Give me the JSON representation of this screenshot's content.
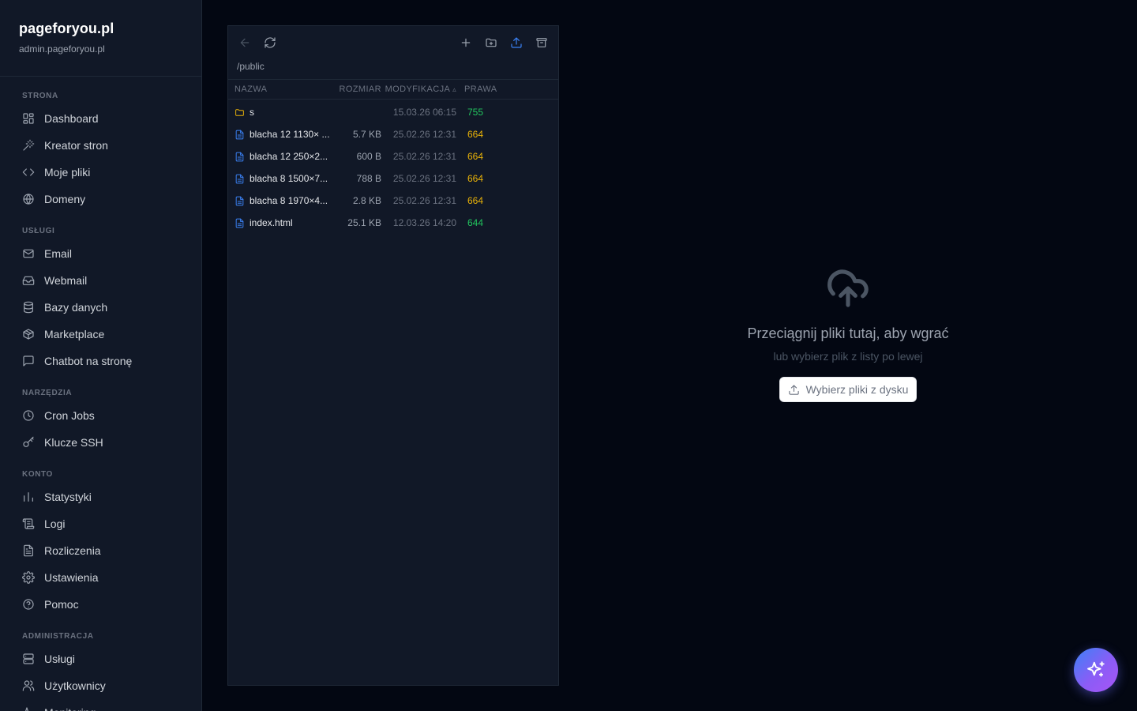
{
  "brand": {
    "title": "pageforyou.pl",
    "subtitle": "admin.pageforyou.pl"
  },
  "sidebar": {
    "sections": [
      {
        "title": "STRONA",
        "items": [
          {
            "label": "Dashboard",
            "icon": "dashboard-icon"
          },
          {
            "label": "Kreator stron",
            "icon": "wand-icon"
          },
          {
            "label": "Moje pliki",
            "icon": "code-icon"
          },
          {
            "label": "Domeny",
            "icon": "globe-icon"
          }
        ]
      },
      {
        "title": "USŁUGI",
        "items": [
          {
            "label": "Email",
            "icon": "mail-icon"
          },
          {
            "label": "Webmail",
            "icon": "inbox-icon"
          },
          {
            "label": "Bazy danych",
            "icon": "database-icon"
          },
          {
            "label": "Marketplace",
            "icon": "package-icon"
          },
          {
            "label": "Chatbot na stronę",
            "icon": "chat-icon"
          }
        ]
      },
      {
        "title": "NARZĘDZIA",
        "items": [
          {
            "label": "Cron Jobs",
            "icon": "clock-icon"
          },
          {
            "label": "Klucze SSH",
            "icon": "key-icon"
          }
        ]
      },
      {
        "title": "KONTO",
        "items": [
          {
            "label": "Statystyki",
            "icon": "bar-chart-icon"
          },
          {
            "label": "Logi",
            "icon": "scroll-icon"
          },
          {
            "label": "Rozliczenia",
            "icon": "receipt-icon"
          },
          {
            "label": "Ustawienia",
            "icon": "gear-icon"
          },
          {
            "label": "Pomoc",
            "icon": "help-icon"
          }
        ]
      },
      {
        "title": "ADMINISTRACJA",
        "items": [
          {
            "label": "Usługi",
            "icon": "server-icon"
          },
          {
            "label": "Użytkownicy",
            "icon": "users-icon"
          },
          {
            "label": "Monitoring",
            "icon": "activity-icon"
          }
        ]
      }
    ]
  },
  "file_panel": {
    "path": "/public",
    "columns": {
      "name": "NAZWA",
      "size": "ROZMIAR",
      "modified": "MODYFIKACJA",
      "sort_indicator": "▵",
      "perms": "PRAWA"
    },
    "files": [
      {
        "type": "folder",
        "name": "s",
        "size": "",
        "modified": "15.03.26 06:15",
        "perms": "755"
      },
      {
        "type": "file",
        "name": "blacha 12 1130× ...",
        "size": "5.7 KB",
        "modified": "25.02.26 12:31",
        "perms": "664"
      },
      {
        "type": "file",
        "name": "blacha 12 250×2...",
        "size": "600 B",
        "modified": "25.02.26 12:31",
        "perms": "664"
      },
      {
        "type": "file",
        "name": "blacha 8 1500×7...",
        "size": "788 B",
        "modified": "25.02.26 12:31",
        "perms": "664"
      },
      {
        "type": "file",
        "name": "blacha 8 1970×4...",
        "size": "2.8 KB",
        "modified": "25.02.26 12:31",
        "perms": "664"
      },
      {
        "type": "file",
        "name": "index.html",
        "size": "25.1 KB",
        "modified": "12.03.26 14:20",
        "perms": "644"
      }
    ]
  },
  "dropzone": {
    "title": "Przeciągnij pliki tutaj, aby wgrać",
    "subtitle": "lub wybierz plik z listy po lewej",
    "button_label": "Wybierz pliki z dysku"
  },
  "colors": {
    "perm_green": "#22c55e",
    "perm_yellow": "#eab308",
    "folder": "#eab308",
    "file": "#3b82f6",
    "accent_blue": "#3b82f6"
  }
}
